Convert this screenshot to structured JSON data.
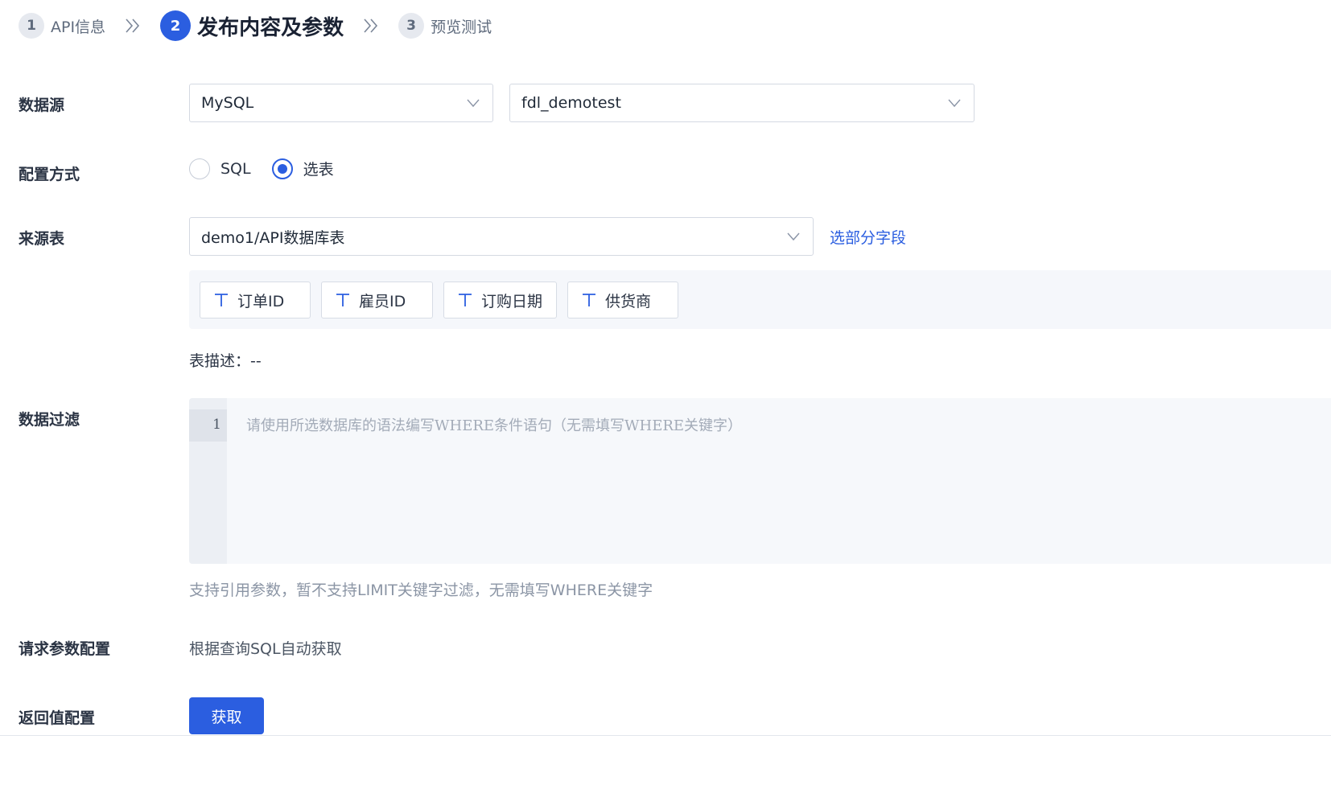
{
  "steps": [
    {
      "num": "1",
      "label": "API信息"
    },
    {
      "num": "2",
      "label": "发布内容及参数"
    },
    {
      "num": "3",
      "label": "预览测试"
    }
  ],
  "form": {
    "datasource": {
      "label": "数据源",
      "type_value": "MySQL",
      "conn_value": "fdl_demotest"
    },
    "config_mode": {
      "label": "配置方式",
      "options": [
        {
          "label": "SQL",
          "checked": false
        },
        {
          "label": "选表",
          "checked": true
        }
      ]
    },
    "source_table": {
      "label": "来源表",
      "value": "demo1/API数据库表",
      "select_fields_link": "选部分字段",
      "fields": [
        "订单ID",
        "雇员ID",
        "订购日期",
        "供货商"
      ],
      "description": "表描述：--"
    },
    "data_filter": {
      "label": "数据过滤",
      "line_number": "1",
      "placeholder": "请使用所选数据库的语法编写WHERE条件语句（无需填写WHERE关键字）",
      "hint": "支持引用参数，暂不支持LIMIT关键字过滤，无需填写WHERE关键字"
    },
    "request_params": {
      "label": "请求参数配置",
      "value": "根据查询SQL自动获取"
    },
    "return_config": {
      "label": "返回值配置",
      "button": "获取"
    }
  },
  "colors": {
    "accent": "#2b5ee0",
    "text": "#2b3444",
    "muted": "#8b95a5"
  }
}
